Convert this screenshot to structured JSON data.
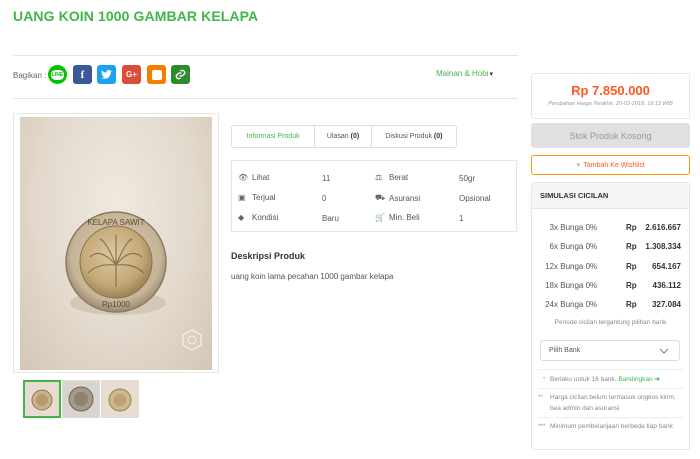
{
  "product": {
    "title": "UANG KOIN 1000 GAMBAR KELAPA",
    "category": "Mainan & Hobi",
    "coin_inscription_top": "KELAPA SAWIT",
    "coin_inscription_bottom": "Rp1000"
  },
  "share": {
    "label": "Bagikan :",
    "buttons": [
      {
        "name": "line",
        "text": "LINE",
        "color": "#00c300"
      },
      {
        "name": "facebook",
        "text": "f",
        "color": "#3b5998"
      },
      {
        "name": "twitter",
        "text": "t",
        "color": "#1da1f2"
      },
      {
        "name": "google-plus",
        "text": "G+",
        "color": "#dd4b39"
      },
      {
        "name": "blogger",
        "text": "B",
        "color": "#f57d00"
      },
      {
        "name": "copy-link",
        "text": "link",
        "color": "#2e8b2e"
      }
    ]
  },
  "tabs": [
    {
      "label": "Informasi Produk",
      "count": ""
    },
    {
      "label": "Ulasan",
      "count": "(0)"
    },
    {
      "label": "Diskusi Produk",
      "count": "(0)"
    }
  ],
  "info": {
    "lihat_label": "Lihat",
    "lihat_value": "11",
    "berat_label": "Berat",
    "berat_value": "50gr",
    "terjual_label": "Terjual",
    "terjual_value": "0",
    "asuransi_label": "Asuransi",
    "asuransi_value": "Opsional",
    "kondisi_label": "Kondisi",
    "kondisi_value": "Baru",
    "minbeli_label": "Min. Beli",
    "minbeli_value": "1"
  },
  "description": {
    "title": "Deskripsi Produk",
    "text": "uang koin lama pecahan 1000 gambar kelapa"
  },
  "pricing": {
    "price": "Rp 7.850.000",
    "note": "Perubahan Harga Terakhir: 20-02-2018, 19:13 WIB",
    "stock_button": "Stok Produk Kosong",
    "wishlist_button": "Tambah Ke Wishlist"
  },
  "installment": {
    "header": "SIMULASI CICILAN",
    "rows": [
      {
        "months": "3x",
        "rate": "Bunga 0%",
        "currency": "Rp",
        "amount": "2.616.667"
      },
      {
        "months": "6x",
        "rate": "Bunga 0%",
        "currency": "Rp",
        "amount": "1.308.334"
      },
      {
        "months": "12x",
        "rate": "Bunga 0%",
        "currency": "Rp",
        "amount": "654.167"
      },
      {
        "months": "18x",
        "rate": "Bunga 0%",
        "currency": "Rp",
        "amount": "436.112"
      },
      {
        "months": "24x",
        "rate": "Bunga 0%",
        "currency": "Rp",
        "amount": "327.084"
      }
    ],
    "period_note": "Periode cicilan tergantung pilihan bank",
    "bank_placeholder": "Pilih Bank",
    "note1_star": "*",
    "note1_text": "Berlaku untuk 16 bank.",
    "note1_link": "Bandingkan",
    "note2_star": "**",
    "note2_text": "Harga cicilan belum termasuk ongkos kirim, bea admin dan asuransi",
    "note3_star": "***",
    "note3_text": "Minimum pembelanjaan berbeda tiap bank"
  },
  "colors": {
    "brand_green": "#42b549",
    "price_orange": "#ff5722",
    "wishlist_border": "#ff9800"
  }
}
